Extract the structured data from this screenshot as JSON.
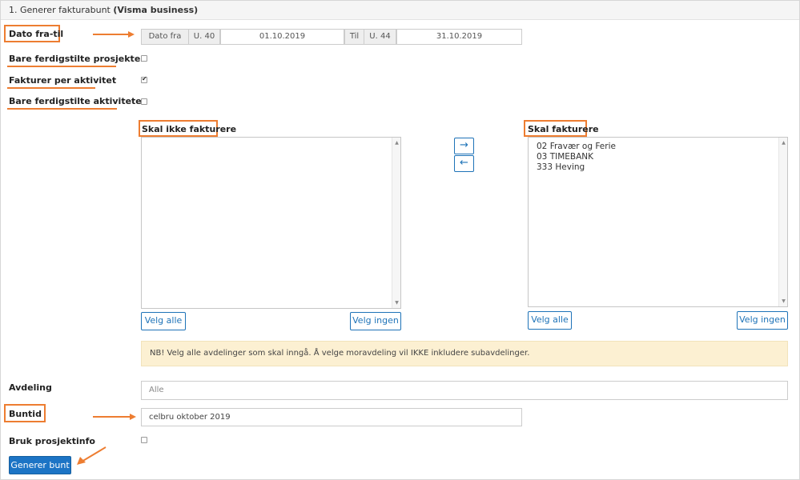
{
  "header": {
    "prefix": "1. Generer fakturabunt",
    "system": "(Visma business)"
  },
  "labels": {
    "dato": "Dato fra-til",
    "bare_prosjekter": "Bare ferdigstilte prosjekter",
    "per_aktivitet": "Fakturer per aktivitet",
    "bare_aktiviteter": "Bare ferdigstilte aktiviteter",
    "avdeling": "Avdeling",
    "buntid": "Buntid",
    "prosjektinfo": "Bruk prosjektinfo"
  },
  "date": {
    "from_label": "Dato fra",
    "from_week": "U. 40",
    "from_value": "01.10.2019",
    "to_label": "Til",
    "to_week": "U. 44",
    "to_value": "31.10.2019"
  },
  "checkboxes": {
    "bare_prosjekter": false,
    "per_aktivitet": true,
    "bare_aktiviteter": false,
    "prosjektinfo": false
  },
  "lists": {
    "left_title": "Skal ikke fakturere",
    "right_title": "Skal fakturere",
    "right_items": [
      "02 Fravær og Ferie",
      "03 TIMEBANK",
      "333 Heving"
    ]
  },
  "buttons": {
    "velg_alle": "Velg alle",
    "velg_ingen": "Velg ingen",
    "generer": "Generer bunt",
    "move_right_icon": "arrow-right-icon",
    "move_left_icon": "arrow-left-icon"
  },
  "notice": "NB! Velg alle avdelinger som skal inngå. Å velge moravdeling vil IKKE inkludere subavdelinger.",
  "inputs": {
    "avdeling_placeholder": "Alle",
    "buntid_value": "celbru oktober 2019"
  },
  "colors": {
    "annotation": "#ed7d31",
    "primary": "#1c74c5",
    "notice_bg": "#fcf0d2"
  }
}
